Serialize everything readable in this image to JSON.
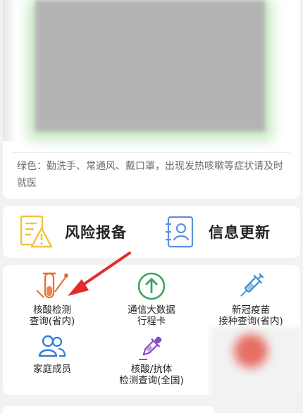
{
  "qr": {
    "notice": "绿色：勤洗手、常通风、戴口罩，出现发热咳嗽等症状请及时就医"
  },
  "actions": [
    {
      "label": "风险报备",
      "icon": "risk-report-icon"
    },
    {
      "label": "信息更新",
      "icon": "info-update-icon"
    }
  ],
  "services": [
    {
      "lines": [
        "核酸检测",
        "查询(省内)"
      ],
      "icon": "test-tube-icon"
    },
    {
      "lines": [
        "通信大数据",
        "行程卡"
      ],
      "icon": "arrow-up-circle-icon"
    },
    {
      "lines": [
        "新冠疫苗",
        "接种查询(省内)"
      ],
      "icon": "syringe-icon"
    },
    {
      "lines": [
        "家庭成员"
      ],
      "icon": "family-members-icon"
    },
    {
      "lines": [
        "核酸/抗体",
        "检测查询(全国)"
      ],
      "icon": "dropper-icon"
    }
  ],
  "colors": {
    "qr_green": "#8fd28a",
    "action_yellow": "#f2c33d",
    "action_blue": "#5b8fe0",
    "tube_orange": "#ec6d2a",
    "trip_green": "#3aa55a",
    "vaccine_blue": "#3a8fd6",
    "family_blue": "#2f7bd8",
    "dropper_purple": "#8b4cc4",
    "annotation_red": "#e22b2b"
  }
}
